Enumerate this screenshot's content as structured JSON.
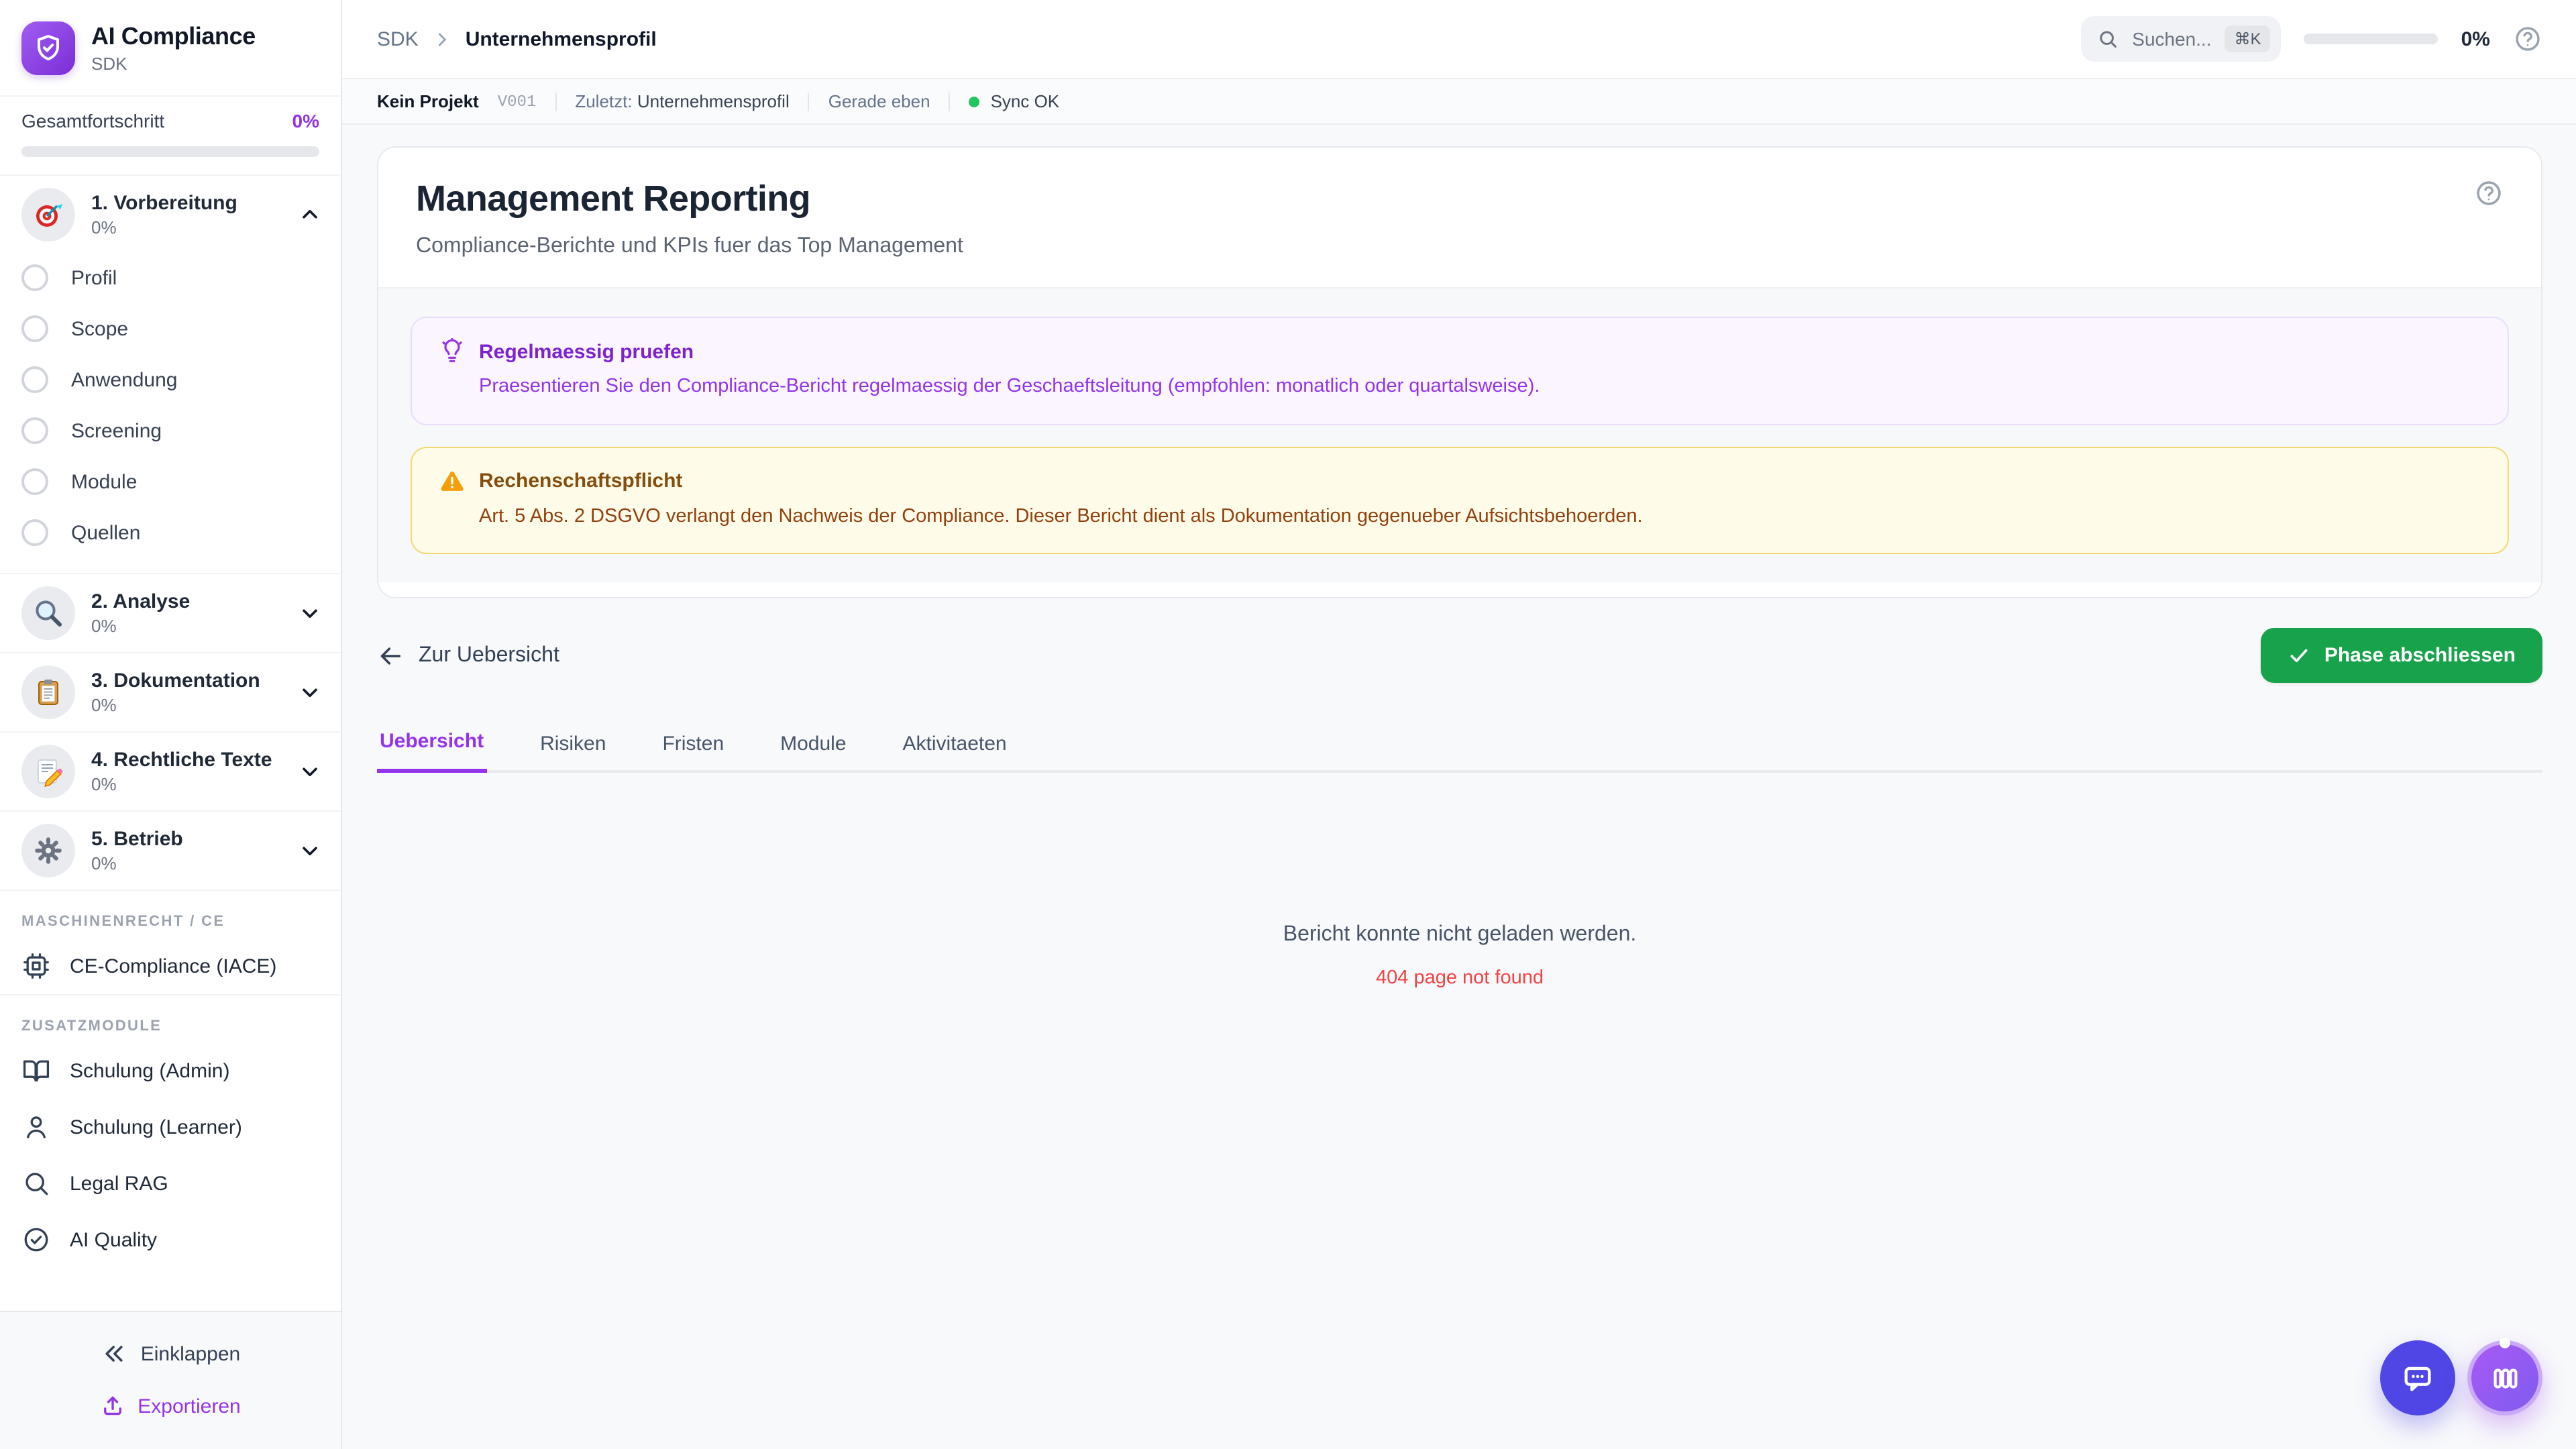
{
  "app": {
    "title": "AI Compliance",
    "subtitle": "SDK",
    "logo_icon": "shield-check-icon"
  },
  "colors": {
    "accent_purple": "#9333ea",
    "success_green": "#18a24b",
    "sync_green": "#22c55e",
    "error_red": "#ef4444",
    "chat_fab_indigo": "#4f46e5",
    "warning_amber": "#f59e0b"
  },
  "sidebar": {
    "progress_label": "Gesamtfortschritt",
    "progress_value": "0%",
    "phases": [
      {
        "icon": "target-emoji",
        "label": "1. Vorbereitung",
        "percent": "0%",
        "expanded": true,
        "children": [
          "Profil",
          "Scope",
          "Anwendung",
          "Screening",
          "Module",
          "Quellen"
        ]
      },
      {
        "icon": "magnifier-emoji",
        "label": "2. Analyse",
        "percent": "0%",
        "expanded": false
      },
      {
        "icon": "clipboard-emoji",
        "label": "3. Dokumentation",
        "percent": "0%",
        "expanded": false
      },
      {
        "icon": "memo-emoji",
        "label": "4. Rechtliche Texte",
        "percent": "0%",
        "expanded": false
      },
      {
        "icon": "gear-emoji",
        "label": "5. Betrieb",
        "percent": "0%",
        "expanded": false
      }
    ],
    "sections": [
      {
        "header": "MASCHINENRECHT / CE",
        "items": [
          {
            "icon": "chip-icon",
            "label": "CE-Compliance (IACE)"
          }
        ]
      },
      {
        "header": "ZUSATZMODULE",
        "items": [
          {
            "icon": "book-open-icon",
            "label": "Schulung (Admin)"
          },
          {
            "icon": "user-icon",
            "label": "Schulung (Learner)"
          },
          {
            "icon": "search-icon",
            "label": "Legal RAG"
          },
          {
            "icon": "check-circle-icon",
            "label": "AI Quality"
          }
        ]
      }
    ],
    "footer": {
      "collapse_label": "Einklappen",
      "export_label": "Exportieren"
    }
  },
  "header": {
    "breadcrumb_root": "SDK",
    "breadcrumb_current": "Unternehmensprofil",
    "search_placeholder": "Suchen...",
    "search_shortcut": "⌘K",
    "progress_value": "0%"
  },
  "statusbar": {
    "project": "Kein Projekt",
    "version": "V001",
    "last_label": "Zuletzt:",
    "last_value": "Unternehmensprofil",
    "time": "Gerade eben",
    "sync": "Sync OK"
  },
  "page": {
    "title": "Management Reporting",
    "subtitle": "Compliance-Berichte und KPIs fuer das Top Management",
    "callouts": [
      {
        "type": "tip",
        "icon": "lightbulb-icon",
        "title": "Regelmaessig pruefen",
        "text": "Praesentieren Sie den Compliance-Bericht regelmaessig der Geschaeftsleitung (empfohlen: monatlich oder quartalsweise)."
      },
      {
        "type": "warning",
        "icon": "warning-triangle-icon",
        "title": "Rechenschaftspflicht",
        "text": "Art. 5 Abs. 2 DSGVO verlangt den Nachweis der Compliance. Dieser Bericht dient als Dokumentation gegenueber Aufsichtsbehoerden."
      }
    ],
    "back_label": "Zur Uebersicht",
    "complete_label": "Phase abschliessen",
    "tabs": [
      {
        "label": "Uebersicht",
        "active": true
      },
      {
        "label": "Risiken",
        "active": false
      },
      {
        "label": "Fristen",
        "active": false
      },
      {
        "label": "Module",
        "active": false
      },
      {
        "label": "Aktivitaeten",
        "active": false
      }
    ],
    "empty_state": {
      "message": "Bericht konnte nicht geladen werden.",
      "error": "404 page not found"
    }
  }
}
